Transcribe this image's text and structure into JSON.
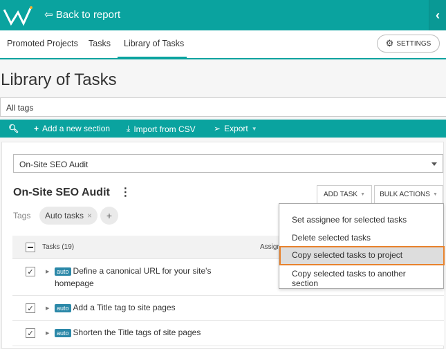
{
  "colors": {
    "brand": "#0aa39f",
    "highlight": "#e8822c",
    "badge": "#2b88a8"
  },
  "header": {
    "back_label": "Back to report",
    "collapse_icon": "chevron-left"
  },
  "nav": {
    "tabs": [
      {
        "label": "Promoted Projects"
      },
      {
        "label": "Tasks"
      },
      {
        "label": "Library of Tasks",
        "active": true
      }
    ],
    "settings_label": "SETTINGS"
  },
  "page": {
    "title": "Library of Tasks",
    "tags_filter": "All tags"
  },
  "toolbar": {
    "add_section": "Add a new section",
    "import_csv": "Import from CSV",
    "export": "Export"
  },
  "section": {
    "selected": "On-Site SEO Audit",
    "title": "On-Site SEO Audit",
    "add_task": "ADD TASK",
    "bulk_actions": "BULK ACTIONS",
    "tags_label": "Tags",
    "tag": "Auto tasks",
    "add_tag": "+"
  },
  "table": {
    "header": "Tasks (19)",
    "assignee_header": "Assign",
    "rows": [
      {
        "badge": "auto",
        "text": "Define a canonical URL for your site's homepage",
        "checked": true
      },
      {
        "badge": "auto",
        "text": "Add a Title tag to site pages",
        "checked": true
      },
      {
        "badge": "auto",
        "text": "Shorten the Title tags of site pages",
        "checked": true
      }
    ]
  },
  "bulk_menu": {
    "items": [
      {
        "label": "Set assignee for selected tasks"
      },
      {
        "label": "Delete selected tasks"
      },
      {
        "label": "Copy selected tasks to project",
        "highlighted": true
      },
      {
        "label": "Copy selected tasks to another section"
      }
    ]
  }
}
